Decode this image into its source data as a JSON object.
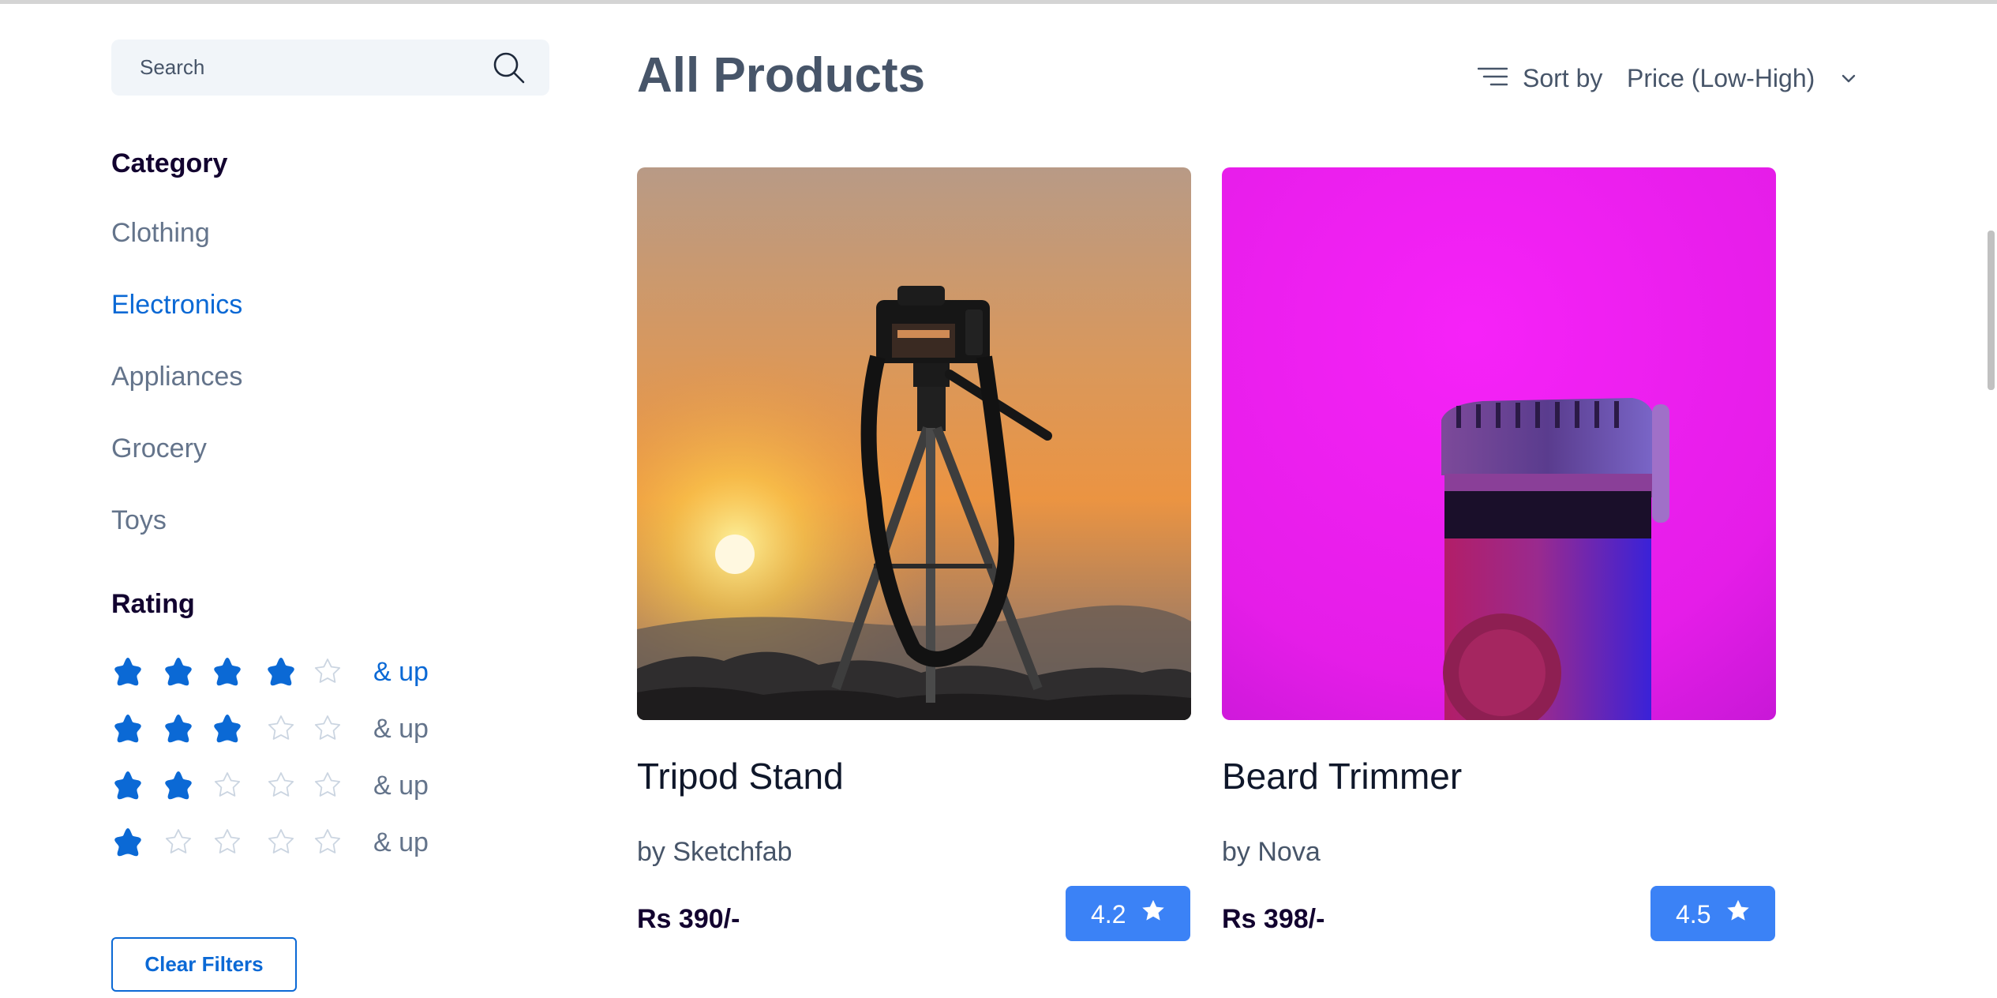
{
  "search": {
    "placeholder": "Search"
  },
  "category": {
    "title": "Category",
    "items": [
      {
        "label": "Clothing",
        "active": false
      },
      {
        "label": "Electronics",
        "active": true
      },
      {
        "label": "Appliances",
        "active": false
      },
      {
        "label": "Grocery",
        "active": false
      },
      {
        "label": "Toys",
        "active": false
      }
    ]
  },
  "rating": {
    "title": "Rating",
    "options": [
      {
        "filled": 4,
        "total": 5,
        "label": "& up"
      },
      {
        "filled": 3,
        "total": 5,
        "label": "& up"
      },
      {
        "filled": 2,
        "total": 5,
        "label": "& up"
      },
      {
        "filled": 1,
        "total": 5,
        "label": "& up"
      }
    ]
  },
  "clear_filters_label": "Clear Filters",
  "page_title": "All Products",
  "sort": {
    "label": "Sort by",
    "value": "Price (Low-High)"
  },
  "products": [
    {
      "title": "Tripod Stand",
      "brand": "by Sketchfab",
      "price": "Rs 390/-",
      "rating": "4.2",
      "image": "tripod-camera-sunset"
    },
    {
      "title": "Beard Trimmer",
      "brand": "by Nova",
      "price": "Rs 398/-",
      "rating": "4.5",
      "image": "beard-trimmer-magenta"
    }
  ],
  "colors": {
    "accent": "#0b69d5",
    "rating_badge": "#3b82f6",
    "muted_text": "#64748b",
    "heading": "#12022f",
    "star_empty": "#cbd5e1",
    "search_bg": "#f1f5f9"
  },
  "icons": {
    "search": "search-icon",
    "sort": "sort-icon",
    "chevron": "chevron-down-icon",
    "star": "star-icon"
  }
}
